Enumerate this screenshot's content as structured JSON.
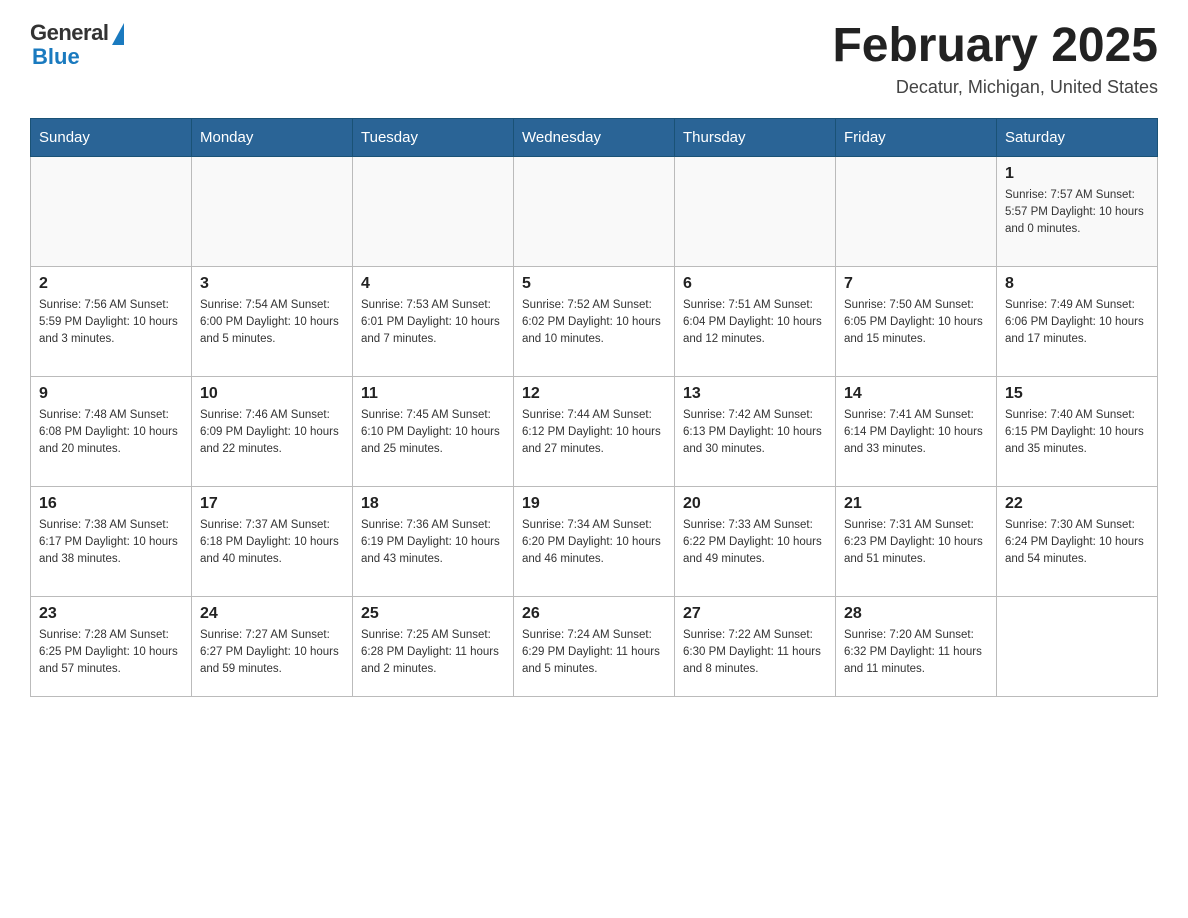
{
  "header": {
    "logo": {
      "general": "General",
      "blue": "Blue"
    },
    "title": "February 2025",
    "location": "Decatur, Michigan, United States"
  },
  "weekdays": [
    "Sunday",
    "Monday",
    "Tuesday",
    "Wednesday",
    "Thursday",
    "Friday",
    "Saturday"
  ],
  "weeks": [
    [
      {
        "day": "",
        "info": ""
      },
      {
        "day": "",
        "info": ""
      },
      {
        "day": "",
        "info": ""
      },
      {
        "day": "",
        "info": ""
      },
      {
        "day": "",
        "info": ""
      },
      {
        "day": "",
        "info": ""
      },
      {
        "day": "1",
        "info": "Sunrise: 7:57 AM\nSunset: 5:57 PM\nDaylight: 10 hours and 0 minutes."
      }
    ],
    [
      {
        "day": "2",
        "info": "Sunrise: 7:56 AM\nSunset: 5:59 PM\nDaylight: 10 hours and 3 minutes."
      },
      {
        "day": "3",
        "info": "Sunrise: 7:54 AM\nSunset: 6:00 PM\nDaylight: 10 hours and 5 minutes."
      },
      {
        "day": "4",
        "info": "Sunrise: 7:53 AM\nSunset: 6:01 PM\nDaylight: 10 hours and 7 minutes."
      },
      {
        "day": "5",
        "info": "Sunrise: 7:52 AM\nSunset: 6:02 PM\nDaylight: 10 hours and 10 minutes."
      },
      {
        "day": "6",
        "info": "Sunrise: 7:51 AM\nSunset: 6:04 PM\nDaylight: 10 hours and 12 minutes."
      },
      {
        "day": "7",
        "info": "Sunrise: 7:50 AM\nSunset: 6:05 PM\nDaylight: 10 hours and 15 minutes."
      },
      {
        "day": "8",
        "info": "Sunrise: 7:49 AM\nSunset: 6:06 PM\nDaylight: 10 hours and 17 minutes."
      }
    ],
    [
      {
        "day": "9",
        "info": "Sunrise: 7:48 AM\nSunset: 6:08 PM\nDaylight: 10 hours and 20 minutes."
      },
      {
        "day": "10",
        "info": "Sunrise: 7:46 AM\nSunset: 6:09 PM\nDaylight: 10 hours and 22 minutes."
      },
      {
        "day": "11",
        "info": "Sunrise: 7:45 AM\nSunset: 6:10 PM\nDaylight: 10 hours and 25 minutes."
      },
      {
        "day": "12",
        "info": "Sunrise: 7:44 AM\nSunset: 6:12 PM\nDaylight: 10 hours and 27 minutes."
      },
      {
        "day": "13",
        "info": "Sunrise: 7:42 AM\nSunset: 6:13 PM\nDaylight: 10 hours and 30 minutes."
      },
      {
        "day": "14",
        "info": "Sunrise: 7:41 AM\nSunset: 6:14 PM\nDaylight: 10 hours and 33 minutes."
      },
      {
        "day": "15",
        "info": "Sunrise: 7:40 AM\nSunset: 6:15 PM\nDaylight: 10 hours and 35 minutes."
      }
    ],
    [
      {
        "day": "16",
        "info": "Sunrise: 7:38 AM\nSunset: 6:17 PM\nDaylight: 10 hours and 38 minutes."
      },
      {
        "day": "17",
        "info": "Sunrise: 7:37 AM\nSunset: 6:18 PM\nDaylight: 10 hours and 40 minutes."
      },
      {
        "day": "18",
        "info": "Sunrise: 7:36 AM\nSunset: 6:19 PM\nDaylight: 10 hours and 43 minutes."
      },
      {
        "day": "19",
        "info": "Sunrise: 7:34 AM\nSunset: 6:20 PM\nDaylight: 10 hours and 46 minutes."
      },
      {
        "day": "20",
        "info": "Sunrise: 7:33 AM\nSunset: 6:22 PM\nDaylight: 10 hours and 49 minutes."
      },
      {
        "day": "21",
        "info": "Sunrise: 7:31 AM\nSunset: 6:23 PM\nDaylight: 10 hours and 51 minutes."
      },
      {
        "day": "22",
        "info": "Sunrise: 7:30 AM\nSunset: 6:24 PM\nDaylight: 10 hours and 54 minutes."
      }
    ],
    [
      {
        "day": "23",
        "info": "Sunrise: 7:28 AM\nSunset: 6:25 PM\nDaylight: 10 hours and 57 minutes."
      },
      {
        "day": "24",
        "info": "Sunrise: 7:27 AM\nSunset: 6:27 PM\nDaylight: 10 hours and 59 minutes."
      },
      {
        "day": "25",
        "info": "Sunrise: 7:25 AM\nSunset: 6:28 PM\nDaylight: 11 hours and 2 minutes."
      },
      {
        "day": "26",
        "info": "Sunrise: 7:24 AM\nSunset: 6:29 PM\nDaylight: 11 hours and 5 minutes."
      },
      {
        "day": "27",
        "info": "Sunrise: 7:22 AM\nSunset: 6:30 PM\nDaylight: 11 hours and 8 minutes."
      },
      {
        "day": "28",
        "info": "Sunrise: 7:20 AM\nSunset: 6:32 PM\nDaylight: 11 hours and 11 minutes."
      },
      {
        "day": "",
        "info": ""
      }
    ]
  ]
}
